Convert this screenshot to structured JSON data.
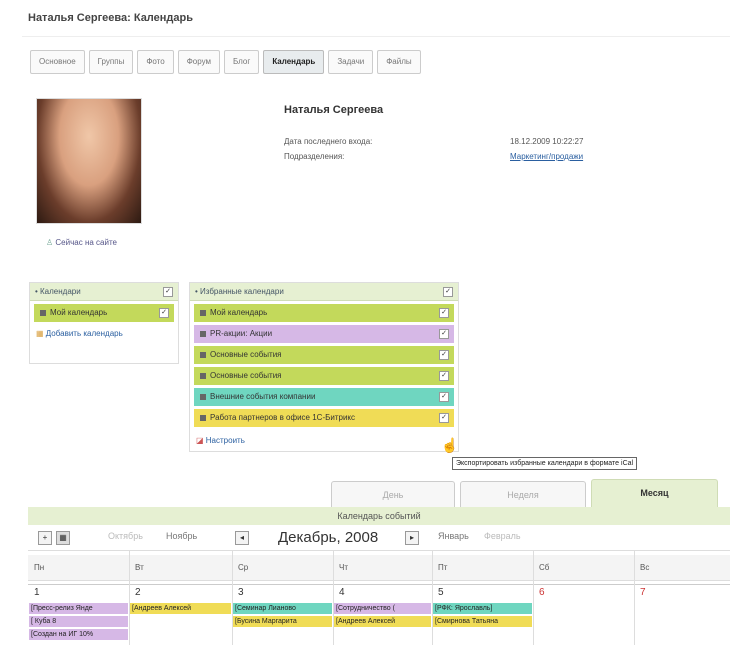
{
  "page_title": "Наталья Сергеева: Календарь",
  "tabs": [
    "Основное",
    "Группы",
    "Фото",
    "Форум",
    "Блог",
    "Календарь",
    "Задачи",
    "Файлы"
  ],
  "active_tab": "Календарь",
  "profile": {
    "name": "Наталья Сергеева",
    "online": "Сейчас на сайте",
    "last_login_label": "Дата последнего входа:",
    "last_login_value": "18.12.2009 10:22:27",
    "department_label": "Подразделения:",
    "department_value": "Маркетинг/продажи"
  },
  "calendars_panel": {
    "title": "• Календари",
    "items": [
      {
        "label": "Мой календарь",
        "color": "#c3d95b"
      }
    ],
    "add_link": "Добавить календарь"
  },
  "favorites_panel": {
    "title": "• Избранные календари",
    "items": [
      {
        "label": "Мой календарь",
        "color": "#c3d95b"
      },
      {
        "label": "PR-акции: Акции",
        "color": "#d6b8e6"
      },
      {
        "label": "Основные события",
        "color": "#c3d95b"
      },
      {
        "label": "Основные события",
        "color": "#c3d95b"
      },
      {
        "label": "Внешние события компании",
        "color": "#6fd6c0"
      },
      {
        "label": "Работа партнеров в офисе 1С-Битрикс",
        "color": "#f0dc56"
      }
    ],
    "settings_link": "Настроить"
  },
  "tooltip": "Экспортировать избранные календари в формате iCal",
  "view_tabs": [
    "День",
    "Неделя",
    "Месяц"
  ],
  "active_view": "Месяц",
  "calendar": {
    "bar_title": "Календарь событий",
    "prev_prev": "Октябрь",
    "prev": "Ноябрь",
    "title": "Декабрь, 2008",
    "next": "Январь",
    "next_next": "Февраль",
    "weekdays": [
      "Пн",
      "Вт",
      "Ср",
      "Чт",
      "Пт",
      "Сб",
      "Вс"
    ],
    "dates": [
      "1",
      "2",
      "3",
      "4",
      "5",
      "6",
      "7"
    ],
    "events": [
      {
        "day": 0,
        "row": 0,
        "text": "[Пресс-релиз Янде",
        "color": "#d6b8e6"
      },
      {
        "day": 0,
        "row": 1,
        "text": "[ Куба      8",
        "color": "#d6b8e6"
      },
      {
        "day": 0,
        "row": 2,
        "text": "[Создан на ИГ 10%",
        "color": "#d6b8e6"
      },
      {
        "day": 1,
        "row": 0,
        "text": "[Андреев Алексей",
        "color": "#f0dc56"
      },
      {
        "day": 2,
        "row": 0,
        "text": "[Семинар Лианово",
        "color": "#6fd6c0"
      },
      {
        "day": 2,
        "row": 1,
        "text": "[Бусина Маргарита",
        "color": "#f0dc56"
      },
      {
        "day": 3,
        "row": 0,
        "text": "[Сотрудничество (",
        "color": "#d6b8e6"
      },
      {
        "day": 3,
        "row": 1,
        "text": "[Андреев Алексей",
        "color": "#f0dc56"
      },
      {
        "day": 4,
        "row": 0,
        "text": "[РФК: Ярославль]",
        "color": "#6fd6c0"
      },
      {
        "day": 4,
        "row": 1,
        "text": "[Смирнова Татьяна",
        "color": "#f0dc56"
      }
    ]
  }
}
